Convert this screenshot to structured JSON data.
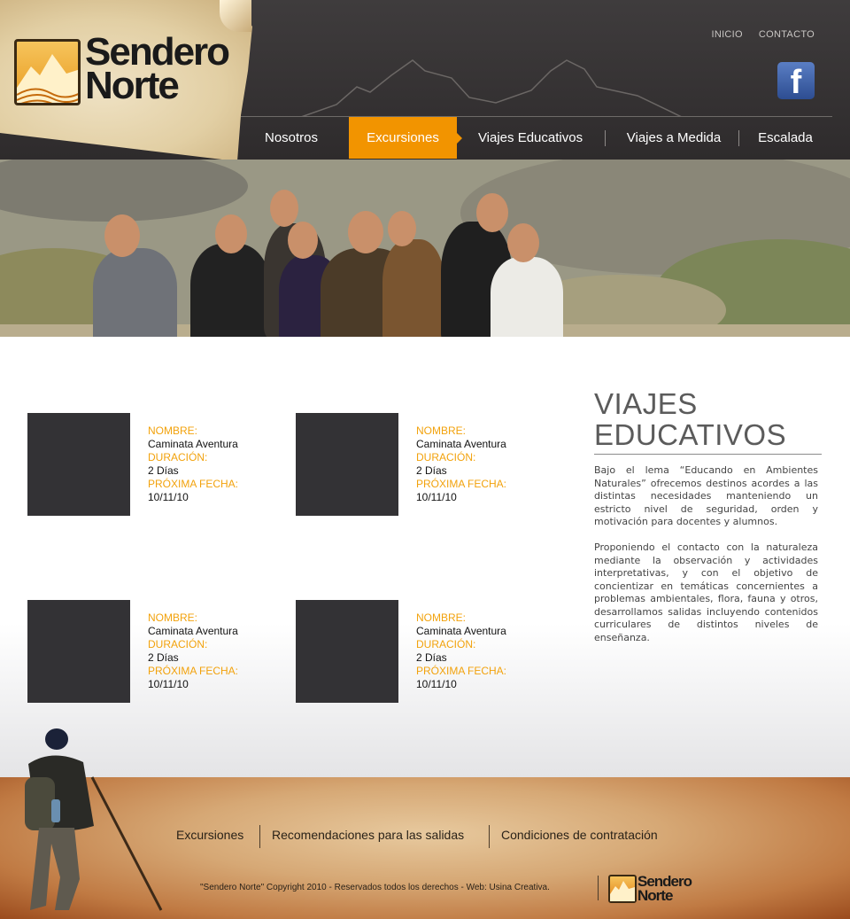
{
  "brand": {
    "name_line1": "Sendero",
    "name_line2": "Norte"
  },
  "toplinks": [
    "INICIO",
    "CONTACTO"
  ],
  "social": {
    "facebook_glyph": "f"
  },
  "nav": {
    "items": [
      "Nosotros",
      "Excursiones",
      "Viajes Educativos",
      "Viajes a Medida",
      "Escalada"
    ],
    "active": "Excursiones"
  },
  "colors": {
    "accent": "#f29400",
    "header": "#363334",
    "thumb": "#333235"
  },
  "cards": [
    {
      "name_label": "NOMBRE:",
      "name": "Caminata Aventura",
      "duration_label": "DURACIÓN:",
      "duration": "2 Días",
      "date_label": "PRÓXIMA FECHA:",
      "date": "10/11/10"
    },
    {
      "name_label": "NOMBRE:",
      "name": "Caminata Aventura",
      "duration_label": "DURACIÓN:",
      "duration": "2 Días",
      "date_label": "PRÓXIMA FECHA:",
      "date": "10/11/10"
    },
    {
      "name_label": "NOMBRE:",
      "name": "Caminata Aventura",
      "duration_label": "DURACIÓN:",
      "duration": "2 Días",
      "date_label": "PRÓXIMA FECHA:",
      "date": "10/11/10"
    },
    {
      "name_label": "NOMBRE:",
      "name": "Caminata Aventura",
      "duration_label": "DURACIÓN:",
      "duration": "2 Días",
      "date_label": "PRÓXIMA FECHA:",
      "date": "10/11/10"
    }
  ],
  "sidebar": {
    "title_line1": "VIAJES",
    "title_line2": "EDUCATIVOS",
    "paragraph1": "Bajo el lema “Educando en Ambientes Naturales” ofrecemos destinos acordes a las distintas necesidades manteniendo un estricto nivel de seguridad, orden y motivación para docentes y alumnos.",
    "paragraph2": "Proponiendo el contacto con la naturaleza mediante la observación y actividades interpretativas, y con el objetivo de concientizar en temáticas concernientes a problemas ambientales, flora, fauna y otros, desarrollamos salidas incluyendo contenidos curriculares de distintos niveles de enseñanza."
  },
  "footer": {
    "links": [
      "Excursiones",
      "Recomendaciones para las salidas",
      "Condiciones de contratación"
    ],
    "copyright": "\"Sendero Norte\" Copyright 2010 - Reservados todos los derechos - Web: Usina Creativa."
  }
}
